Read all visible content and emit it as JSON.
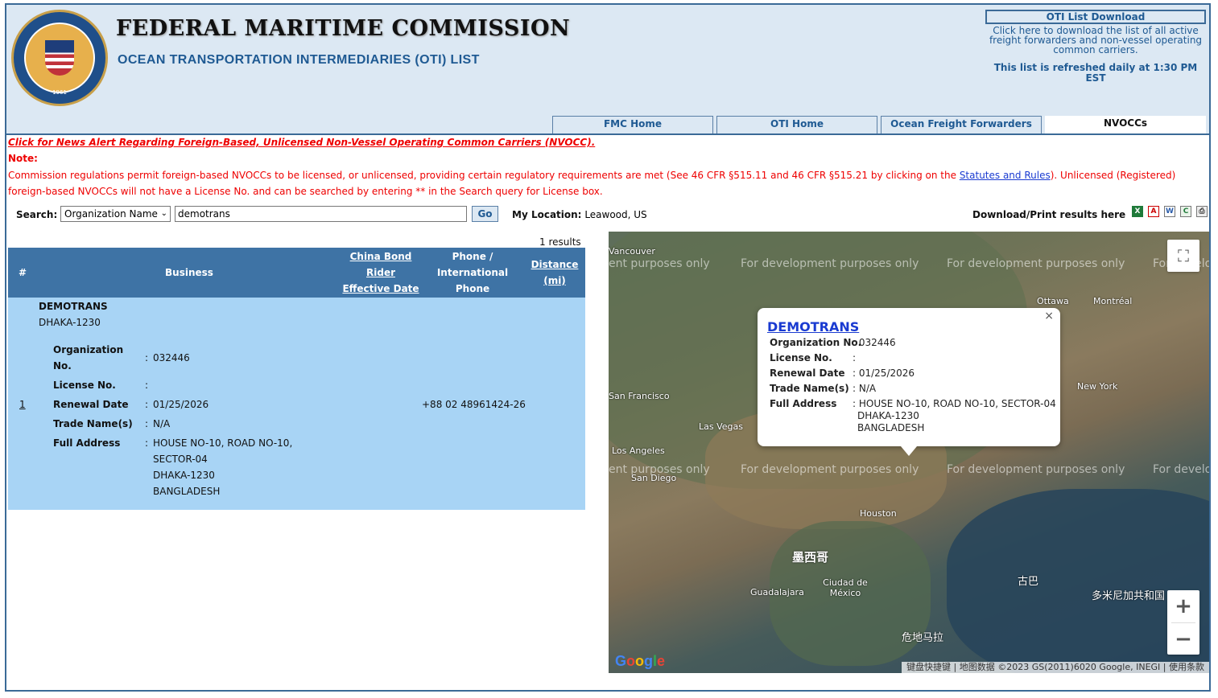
{
  "header": {
    "title": "FEDERAL MARITIME COMMISSION",
    "subtitle": "OCEAN TRANSPORTATION INTERMEDIARIES (OTI) LIST",
    "oti_download_label": "OTI List Download",
    "oti_download_desc": "Click here to download the list of all active freight forwarders and non-vessel operating common carriers.",
    "refresh_note": "This list is refreshed daily at 1:30 PM EST",
    "seal_year": "1961"
  },
  "tabs": [
    {
      "label": "FMC Home"
    },
    {
      "label": "OTI Home"
    },
    {
      "label": "Ocean Freight Forwarders"
    },
    {
      "label": "NVOCCs",
      "active": true
    }
  ],
  "notices": {
    "alert_link": "Click for News Alert Regarding Foreign-Based, Unlicensed Non-Vessel Operating Common Carriers (NVOCC).",
    "note_label": "Note:",
    "regs_text_1": "Commission regulations permit foreign-based NVOCCs to be licensed, or unlicensed, providing certain regulatory requirements are met (See 46 CFR §515.11 and 46 CFR §515.21 by clicking on the ",
    "regs_link": "Statutes and Rules",
    "regs_text_2": "). Unlicensed (Registered) foreign-based NVOCCs will not have a License No. and can be searched by entering ** in the Search query for License box."
  },
  "search": {
    "label": "Search:",
    "field_selected": "Organization Name",
    "query": "demotrans",
    "go_label": "Go",
    "location_label": "My Location:",
    "location_value": "Leawood, US"
  },
  "download": {
    "label": "Download/Print results here",
    "icons": [
      "excel-icon",
      "pdf-icon",
      "word-icon",
      "csv-icon",
      "print-icon"
    ]
  },
  "results": {
    "count_text": "1 results",
    "columns": {
      "num": "#",
      "business": "Business",
      "china_bond_l1": "China Bond",
      "china_bond_l2": "Rider",
      "china_bond_l3": "Effective Date",
      "phone_l1": "Phone /",
      "phone_l2": "International",
      "phone_l3": "Phone",
      "distance_l1": "Distance",
      "distance_l2": "(mi)"
    },
    "row": {
      "index": "1",
      "name": "DEMOTRANS",
      "city": "DHAKA-1230",
      "org_no_label_1": "Organization",
      "org_no_label_2": "No.",
      "org_no": "032446",
      "license_label": "License No.",
      "license": "",
      "renewal_label": "Renewal Date",
      "renewal": "01/25/2026",
      "trade_label": "Trade Name(s)",
      "trade": "N/A",
      "address_label": "Full Address",
      "address_1": "HOUSE NO-10, ROAD NO-10,",
      "address_2": "SECTOR-04",
      "address_3": "DHAKA-1230",
      "address_4": "BANGLADESH",
      "phone": "+88 02 48961424-26",
      "colon": ":"
    }
  },
  "map": {
    "watermark": "For development purposes only",
    "watermark_partial_left": "ent purposes only",
    "watermark_partial_right": "For develo",
    "cities": [
      {
        "name": "Vancouver"
      },
      {
        "name": "Ottawa"
      },
      {
        "name": "Montréal"
      },
      {
        "name": "New York"
      },
      {
        "name": "San Francisco"
      },
      {
        "name": "Las Vegas"
      },
      {
        "name": "Los Angeles"
      },
      {
        "name": "San Diego"
      },
      {
        "name": "Houston"
      },
      {
        "name": "墨西哥"
      },
      {
        "name": "Guadalajara"
      },
      {
        "name": "Ciudad de México"
      },
      {
        "name": "古巴"
      },
      {
        "name": "多米尼加共和国"
      },
      {
        "name": "危地马拉"
      }
    ],
    "attribution": "键盘快捷键 | 地图数据 ©2023 GS(2011)6020 Google, INEGI | 使用条款",
    "google_logo": "Google",
    "zoom_in": "+",
    "zoom_out": "−",
    "popup": {
      "business": "DEMOTRANS",
      "org_label": "Organization No.",
      "org": ": 032446",
      "license_label": "License No.",
      "license": ":",
      "renewal_label": "Renewal Date",
      "renewal": ": 01/25/2026",
      "trade_label": "Trade Name(s)",
      "trade": ": N/A",
      "address_label": "Full Address",
      "address_1": ": HOUSE NO-10, ROAD NO-10, SECTOR-04",
      "address_2": "DHAKA-1230",
      "address_3": "BANGLADESH",
      "close": "×"
    }
  },
  "colors": {
    "brand_blue": "#1f5a93",
    "header_bg": "#dce8f3",
    "table_head": "#3e73a5",
    "row_bg": "#a8d4f5",
    "alert_red": "#e00000"
  }
}
